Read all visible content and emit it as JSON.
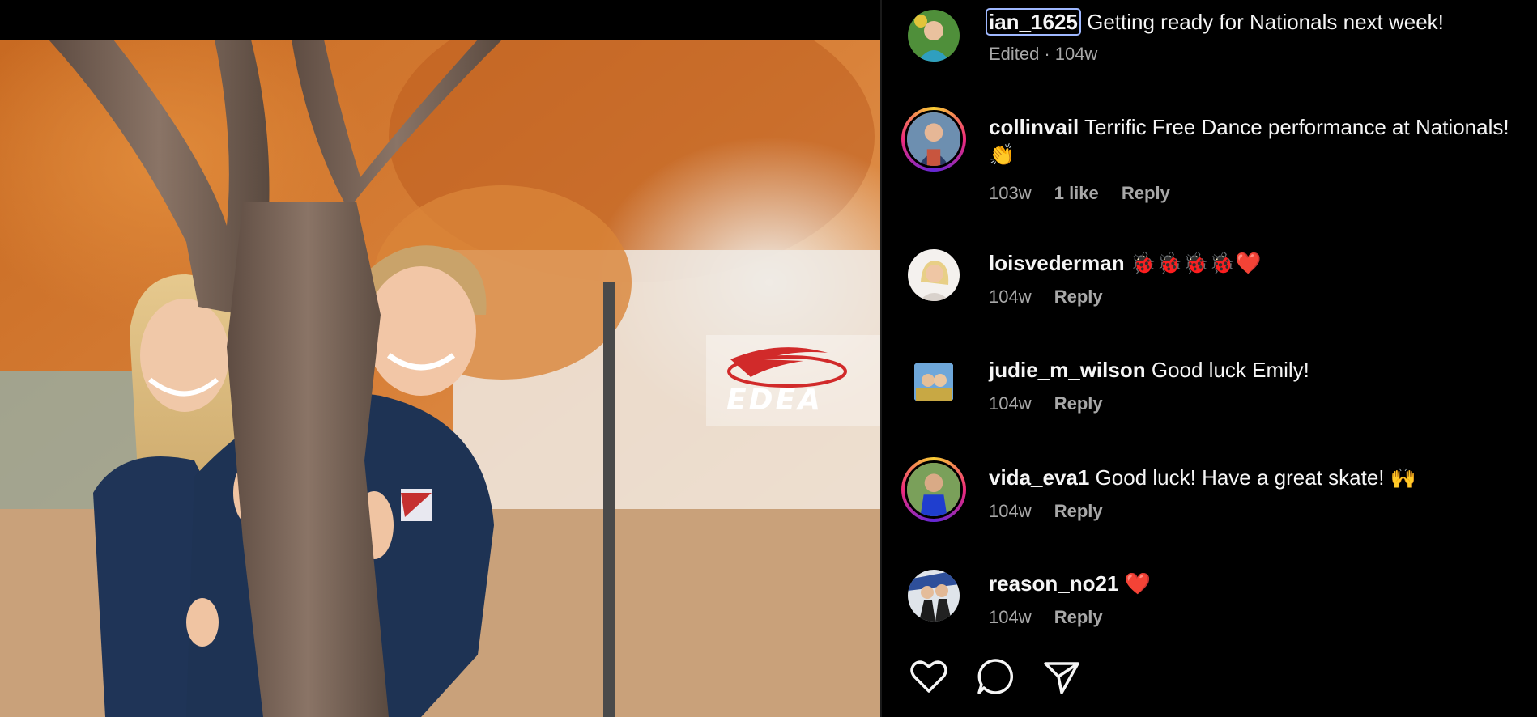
{
  "photo": {
    "watermark": "EDEA"
  },
  "caption": {
    "username": "ian_1625",
    "text": "Getting ready for Nationals next week!",
    "edited": "Edited",
    "separator": "·",
    "time": "104w"
  },
  "comments": [
    {
      "username": "collinvail",
      "text": "Terrific Free Dance performance at Nationals!",
      "emoji_line": "👏",
      "time": "103w",
      "likes": "1 like",
      "reply": "Reply"
    },
    {
      "username": "loisvederman",
      "text": "🐞🐞🐞🐞❤️",
      "time": "104w",
      "reply": "Reply"
    },
    {
      "username": "judie_m_wilson",
      "text": "Good luck Emily!",
      "time": "104w",
      "reply": "Reply"
    },
    {
      "username": "vida_eva1",
      "text": "Good luck! Have a great skate! 🙌",
      "time": "104w",
      "reply": "Reply"
    },
    {
      "username": "reason_no21",
      "text": "❤️",
      "time": "104w",
      "reply": "Reply"
    }
  ],
  "actions": {
    "like_icon": "heart-icon",
    "comment_icon": "comment-icon",
    "share_icon": "send-icon"
  }
}
